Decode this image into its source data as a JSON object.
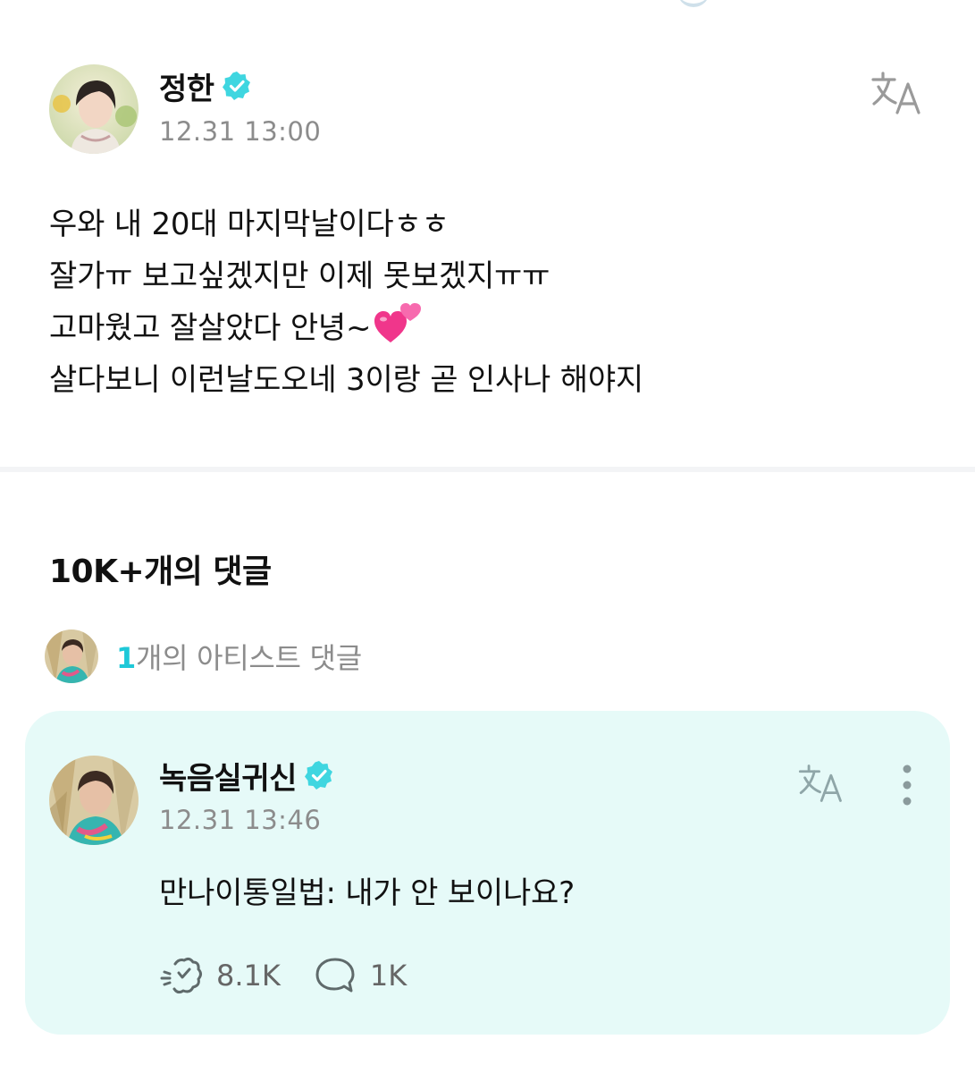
{
  "post": {
    "author": "정한",
    "timestamp": "12.31 13:00",
    "lines": [
      "우와 내 20대 마지막날이다ㅎㅎ",
      "잘가ㅠ 보고싶겠지만 이제 못보겠지ㅠㅠ",
      "고마웠고 잘살았다 안녕~",
      "살다보니 이런날도오네 3이랑 곧 인사나 해야지"
    ],
    "heart_emoji_icon": "two-hearts-icon",
    "translate_icon": "translate-icon",
    "verified_icon": "verified-badge-icon"
  },
  "comments": {
    "count_label": "10K+개의 댓글",
    "artist_count": "1",
    "artist_label": "개의 아티스트 댓글"
  },
  "artist_comment": {
    "author": "녹음실귀신",
    "timestamp": "12.31 13:46",
    "text": "만나이통일법: 내가 안 보이나요?",
    "likes": "8.1K",
    "replies": "1K",
    "like_icon": "like-icon",
    "reply_icon": "comment-bubble-icon",
    "more_icon": "more-vertical-icon"
  },
  "colors": {
    "accent": "#1ec8d8",
    "verified": "#3fd6e0",
    "card_bg": "#e6faf8",
    "muted_text": "#8c8c8c"
  }
}
